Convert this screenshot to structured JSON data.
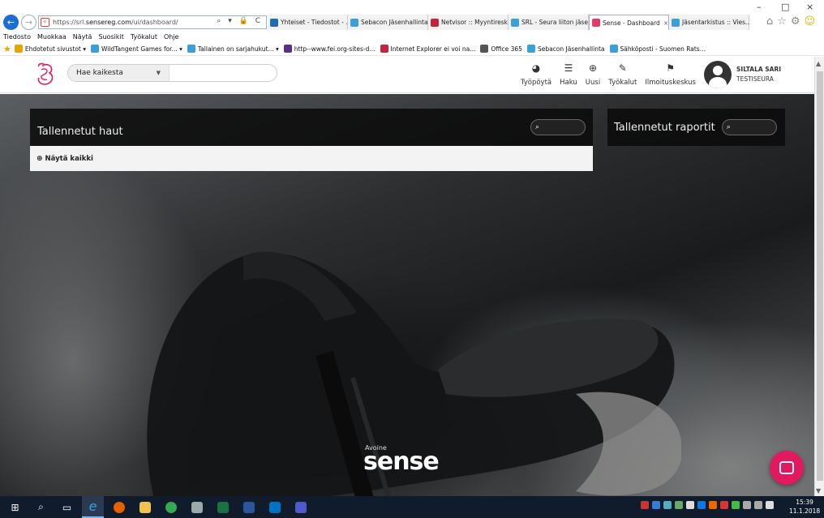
{
  "browser": {
    "url_prefix": "https://srl.",
    "url_domain": "sensereg.com",
    "url_path": "/ui/dashboard/",
    "address_tools": "⌕ ▾ 🔒 C",
    "tabs": [
      {
        "label": "Yhteiset - Tiedostot - ...",
        "color": "#1f6bb5"
      },
      {
        "label": "Sebacon Jäsenhallinta",
        "color": "#3aa0d8"
      },
      {
        "label": "Netvisor :: Myyntiresk...",
        "color": "#c8233c"
      },
      {
        "label": "SRL - Seura liiton jäse...",
        "color": "#3aa0d8"
      },
      {
        "label": "Sense - Dashboard",
        "color": "#e13d6a",
        "active": true
      },
      {
        "label": "Jäsentarkistus :: Vies...",
        "color": "#3aa0d8"
      }
    ],
    "tab_close": "×",
    "menu": [
      "Tiedosto",
      "Muokkaa",
      "Näytä",
      "Suosikit",
      "Työkalut",
      "Ohje"
    ],
    "favorites": [
      {
        "label": "Ehdotetut sivustot ▾",
        "color": "#e8a400"
      },
      {
        "label": "WildTangent Games for... ▾",
        "color": "#3aa0d8"
      },
      {
        "label": "Tallainen on sarjahukut... ▾",
        "color": "#3aa0d8"
      },
      {
        "label": "http--www.fei.org-sites-d...",
        "color": "#5a2f86"
      },
      {
        "label": "Internet Explorer ei voi na...",
        "color": "#c8233c"
      },
      {
        "label": "Office 365",
        "color": "#555555"
      },
      {
        "label": "Sebacon Jäsenhallinta",
        "color": "#3aa0d8"
      },
      {
        "label": "Sähköposti - Suomen Rats...",
        "color": "#3aa0d8"
      }
    ],
    "window_controls": [
      "–",
      "□",
      "×"
    ]
  },
  "header": {
    "search_scope": "Hae kaikesta",
    "search_placeholder": "",
    "nav": [
      {
        "label": "Työpöytä",
        "icon": "dashboard-icon"
      },
      {
        "label": "Haku",
        "icon": "database-icon"
      },
      {
        "label": "Uusi",
        "icon": "plus-circle-icon"
      },
      {
        "label": "Työkalut",
        "icon": "wrench-icon"
      },
      {
        "label": "Ilmoituskeskus",
        "icon": "flag-icon"
      }
    ],
    "user_name": "SILTALA SARI",
    "user_org": "TESTISEURA"
  },
  "saved_searches": {
    "title": "Tallennetut haut",
    "show_all": "Näytä kaikki"
  },
  "saved_reports": {
    "title": "Tallennetut raportit"
  },
  "brand": {
    "small": "Avoine",
    "big": "sense"
  },
  "taskbar": {
    "time": "15:39",
    "date": "11.1.2018"
  },
  "colors": {
    "accent": "#e3195f",
    "ie_blue": "#1c6fd0",
    "taskbar": "#101b2c"
  }
}
